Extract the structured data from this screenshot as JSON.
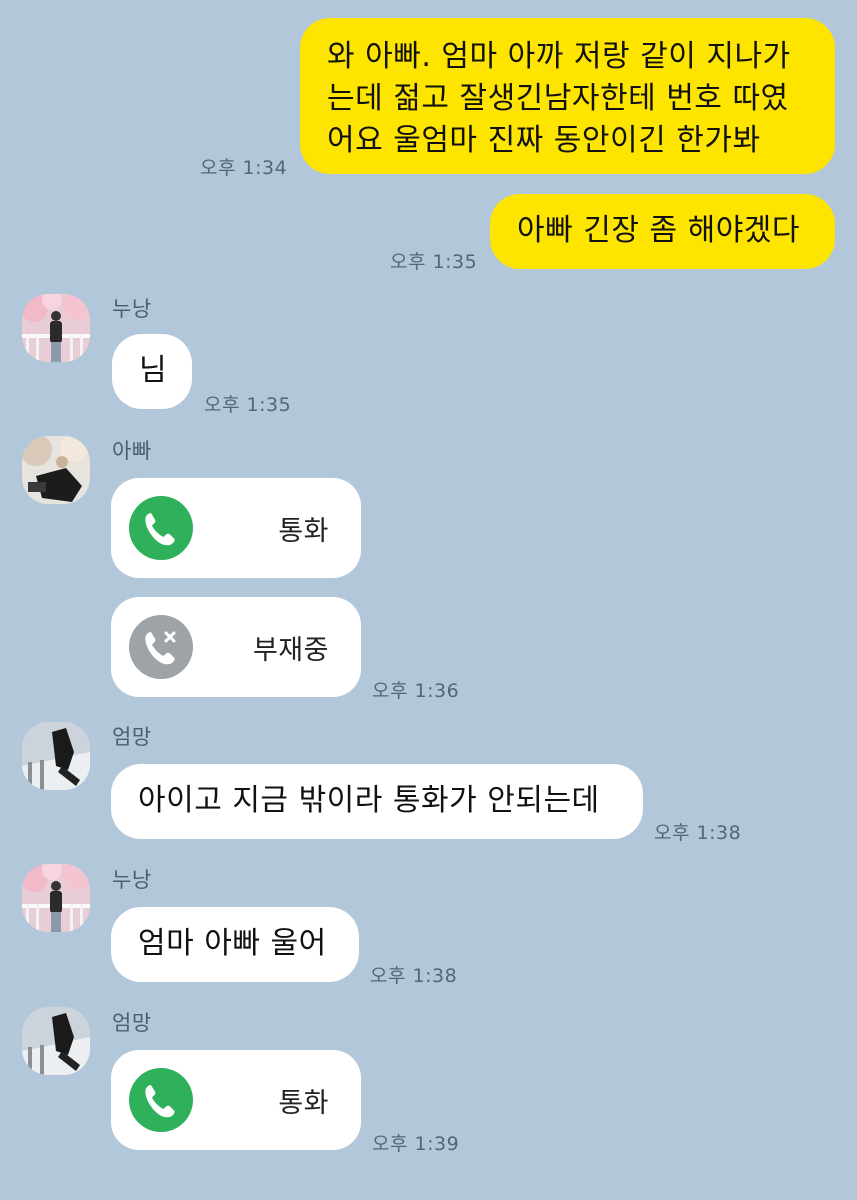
{
  "colors": {
    "background": "#b2c7da",
    "my_bubble": "#fee500",
    "their_bubble": "#ffffff",
    "call_connected": "#2fb05b",
    "call_missed": "#9ea3a8"
  },
  "messages": {
    "m1": {
      "lines": [
        "와 아빠. 엄마 아까 저랑 같이 지나가",
        "는데 젊고 잘생긴남자한테 번호 따였",
        "어요 울엄마 진짜 동안이긴 한가봐"
      ],
      "time": "오후 1:34"
    },
    "m2": {
      "text": "아빠 긴장 좀 해야겠다",
      "time": "오후 1:35"
    },
    "m3": {
      "sender": "누낭",
      "text": "님",
      "time": "오후 1:35"
    },
    "m4": {
      "sender": "아빠",
      "call1": {
        "label": "통화",
        "icon": "phone-icon"
      },
      "call2": {
        "label": "부재중",
        "icon": "missed-call-icon"
      },
      "time": "오후 1:36"
    },
    "m5": {
      "sender": "엄망",
      "text": "아이고 지금 밖이라 통화가 안되는데",
      "time": "오후 1:38"
    },
    "m6": {
      "sender": "누낭",
      "text": "엄마 아빠 울어",
      "time": "오후 1:38"
    },
    "m7": {
      "sender": "엄망",
      "call": {
        "label": "통화",
        "icon": "phone-icon"
      },
      "time": "오후 1:39"
    }
  }
}
